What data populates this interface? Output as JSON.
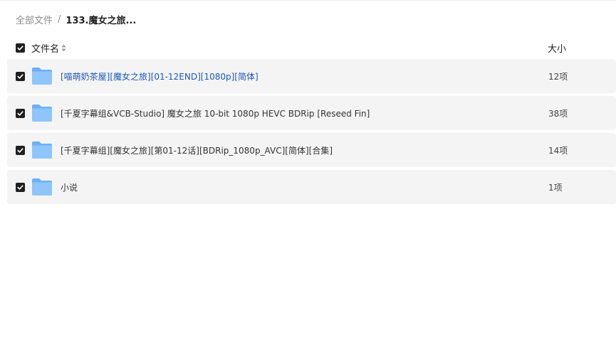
{
  "breadcrumb": {
    "root": "全部文件",
    "separator": "/",
    "current": "133.魔女之旅..."
  },
  "header": {
    "name_label": "文件名",
    "size_label": "大小",
    "checked": true
  },
  "files": [
    {
      "name": "[喵萌奶茶屋][魔女之旅][01-12END][1080p][简体]",
      "size": "12项",
      "checked": true,
      "highlighted": true,
      "icon": "folder-icon"
    },
    {
      "name": "[千夏字幕组&VCB-Studio] 魔女之旅 10-bit 1080p HEVC BDRip [Reseed Fin]",
      "size": "38项",
      "checked": true,
      "highlighted": false,
      "icon": "folder-icon"
    },
    {
      "name": "[千夏字幕组][魔女之旅][第01-12话][BDRip_1080p_AVC][简体][合集]",
      "size": "14项",
      "checked": true,
      "highlighted": false,
      "icon": "folder-icon"
    },
    {
      "name": "小说",
      "size": "1项",
      "checked": true,
      "highlighted": false,
      "icon": "folder-icon"
    }
  ],
  "colors": {
    "link": "#1a56c4",
    "row_bg": "#f4f4f4",
    "checkbox": "#1f1f1f",
    "folder": "#7ab8f5"
  }
}
